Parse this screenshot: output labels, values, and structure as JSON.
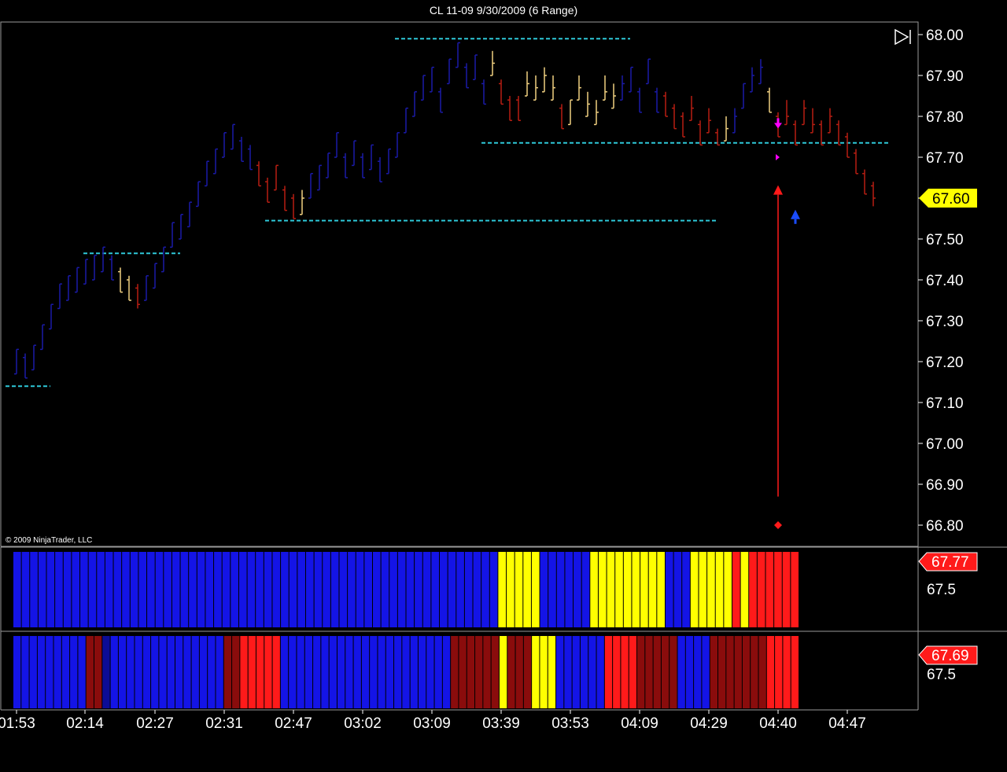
{
  "window": {
    "title": "CL 11-09  9/30/2009 (6 Range)"
  },
  "copyright": "© 2009 NinjaTrader, LLC",
  "colors": {
    "up_bar": "#1a1aa8",
    "down_bar": "#b81e12",
    "neutral_bar": "#f0d080",
    "level_line": "#2ec8d8",
    "panel_blue": "#1414e6",
    "panel_dark_blue": "#0c0c96",
    "panel_yellow": "#ffff00",
    "panel_red": "#ff1a1a",
    "panel_dark_red": "#8a0c0c",
    "signal_red": "#ff1a1a",
    "signal_magenta": "#ff00ff",
    "signal_blue": "#1a4cff",
    "last_price_badge": "#ffff00"
  },
  "price_axis": {
    "ticks": [
      "68.00",
      "67.90",
      "67.80",
      "67.70",
      "67.60",
      "67.50",
      "67.40",
      "67.30",
      "67.20",
      "67.10",
      "67.00",
      "66.90",
      "66.80"
    ],
    "last_price": "67.60"
  },
  "time_axis": {
    "ticks": [
      "01:53",
      "02:14",
      "02:27",
      "02:31",
      "02:47",
      "03:02",
      "03:09",
      "03:39",
      "03:53",
      "04:09",
      "04:29",
      "04:40",
      "04:47"
    ]
  },
  "chart_data": [
    {
      "type": "ohlc",
      "title": "CL 11-09  9/30/2009 (6 Range)",
      "ylim": [
        66.76,
        68.02
      ],
      "levels": [
        {
          "price": 67.14,
          "from_bar": 0,
          "to_bar": 3
        },
        {
          "price": 67.465,
          "from_bar": 9,
          "to_bar": 18
        },
        {
          "price": 67.545,
          "from_bar": 30,
          "to_bar": 80
        },
        {
          "price": 67.735,
          "from_bar": 55,
          "to_bar": 100
        },
        {
          "price": 67.99,
          "from_bar": 45,
          "to_bar": 70
        }
      ],
      "bars": [
        {
          "o": 67.17,
          "h": 67.23,
          "l": 67.17,
          "c": 67.23,
          "d": "up"
        },
        {
          "o": 67.21,
          "h": 67.22,
          "l": 67.16,
          "c": 67.16,
          "d": "up"
        },
        {
          "o": 67.18,
          "h": 67.24,
          "l": 67.18,
          "c": 67.24,
          "d": "up"
        },
        {
          "o": 67.23,
          "h": 67.29,
          "l": 67.23,
          "c": 67.29,
          "d": "up"
        },
        {
          "o": 67.28,
          "h": 67.34,
          "l": 67.28,
          "c": 67.34,
          "d": "up"
        },
        {
          "o": 67.33,
          "h": 67.39,
          "l": 67.33,
          "c": 67.39,
          "d": "up"
        },
        {
          "o": 67.35,
          "h": 67.41,
          "l": 67.35,
          "c": 67.41,
          "d": "up"
        },
        {
          "o": 67.37,
          "h": 67.43,
          "l": 67.37,
          "c": 67.43,
          "d": "up"
        },
        {
          "o": 67.39,
          "h": 67.45,
          "l": 67.39,
          "c": 67.45,
          "d": "up"
        },
        {
          "o": 67.4,
          "h": 67.46,
          "l": 67.4,
          "c": 67.46,
          "d": "up"
        },
        {
          "o": 67.42,
          "h": 67.48,
          "l": 67.42,
          "c": 67.48,
          "d": "up"
        },
        {
          "o": 67.45,
          "h": 67.46,
          "l": 67.4,
          "c": 67.4,
          "d": "up"
        },
        {
          "o": 67.42,
          "h": 67.43,
          "l": 67.37,
          "c": 67.37,
          "d": "neutral"
        },
        {
          "o": 67.4,
          "h": 67.41,
          "l": 67.35,
          "c": 67.35,
          "d": "neutral"
        },
        {
          "o": 67.38,
          "h": 67.39,
          "l": 67.33,
          "c": 67.34,
          "d": "down"
        },
        {
          "o": 67.35,
          "h": 67.41,
          "l": 67.35,
          "c": 67.41,
          "d": "up"
        },
        {
          "o": 67.38,
          "h": 67.44,
          "l": 67.38,
          "c": 67.44,
          "d": "up"
        },
        {
          "o": 67.42,
          "h": 67.48,
          "l": 67.42,
          "c": 67.48,
          "d": "up"
        },
        {
          "o": 67.48,
          "h": 67.54,
          "l": 67.48,
          "c": 67.54,
          "d": "up"
        },
        {
          "o": 67.5,
          "h": 67.56,
          "l": 67.5,
          "c": 67.56,
          "d": "up"
        },
        {
          "o": 67.53,
          "h": 67.59,
          "l": 67.53,
          "c": 67.59,
          "d": "up"
        },
        {
          "o": 67.58,
          "h": 67.64,
          "l": 67.58,
          "c": 67.64,
          "d": "up"
        },
        {
          "o": 67.63,
          "h": 67.69,
          "l": 67.63,
          "c": 67.69,
          "d": "up"
        },
        {
          "o": 67.66,
          "h": 67.72,
          "l": 67.66,
          "c": 67.72,
          "d": "up"
        },
        {
          "o": 67.7,
          "h": 67.76,
          "l": 67.7,
          "c": 67.76,
          "d": "up"
        },
        {
          "o": 67.72,
          "h": 67.78,
          "l": 67.72,
          "c": 67.78,
          "d": "up"
        },
        {
          "o": 67.74,
          "h": 67.75,
          "l": 67.69,
          "c": 67.69,
          "d": "up"
        },
        {
          "o": 67.72,
          "h": 67.73,
          "l": 67.67,
          "c": 67.67,
          "d": "up"
        },
        {
          "o": 67.68,
          "h": 67.69,
          "l": 67.63,
          "c": 67.63,
          "d": "down"
        },
        {
          "o": 67.64,
          "h": 67.65,
          "l": 67.59,
          "c": 67.59,
          "d": "down"
        },
        {
          "o": 67.62,
          "h": 67.68,
          "l": 67.62,
          "c": 67.68,
          "d": "down"
        },
        {
          "o": 67.62,
          "h": 67.63,
          "l": 67.57,
          "c": 67.57,
          "d": "down"
        },
        {
          "o": 67.6,
          "h": 67.61,
          "l": 67.55,
          "c": 67.55,
          "d": "down"
        },
        {
          "o": 67.56,
          "h": 67.62,
          "l": 67.56,
          "c": 67.6,
          "d": "neutral"
        },
        {
          "o": 67.6,
          "h": 67.66,
          "l": 67.6,
          "c": 67.66,
          "d": "up"
        },
        {
          "o": 67.62,
          "h": 67.68,
          "l": 67.62,
          "c": 67.68,
          "d": "up"
        },
        {
          "o": 67.65,
          "h": 67.71,
          "l": 67.65,
          "c": 67.71,
          "d": "up"
        },
        {
          "o": 67.7,
          "h": 67.76,
          "l": 67.7,
          "c": 67.76,
          "d": "up"
        },
        {
          "o": 67.7,
          "h": 67.71,
          "l": 67.65,
          "c": 67.65,
          "d": "up"
        },
        {
          "o": 67.68,
          "h": 67.74,
          "l": 67.68,
          "c": 67.74,
          "d": "up"
        },
        {
          "o": 67.7,
          "h": 67.71,
          "l": 67.65,
          "c": 67.65,
          "d": "up"
        },
        {
          "o": 67.67,
          "h": 67.73,
          "l": 67.67,
          "c": 67.73,
          "d": "up"
        },
        {
          "o": 67.69,
          "h": 67.7,
          "l": 67.64,
          "c": 67.64,
          "d": "up"
        },
        {
          "o": 67.66,
          "h": 67.72,
          "l": 67.66,
          "c": 67.72,
          "d": "up"
        },
        {
          "o": 67.7,
          "h": 67.76,
          "l": 67.7,
          "c": 67.76,
          "d": "up"
        },
        {
          "o": 67.76,
          "h": 67.82,
          "l": 67.76,
          "c": 67.82,
          "d": "up"
        },
        {
          "o": 67.8,
          "h": 67.86,
          "l": 67.8,
          "c": 67.86,
          "d": "up"
        },
        {
          "o": 67.84,
          "h": 67.9,
          "l": 67.84,
          "c": 67.9,
          "d": "up"
        },
        {
          "o": 67.86,
          "h": 67.92,
          "l": 67.86,
          "c": 67.92,
          "d": "up"
        },
        {
          "o": 67.86,
          "h": 67.87,
          "l": 67.81,
          "c": 67.81,
          "d": "up"
        },
        {
          "o": 67.88,
          "h": 67.94,
          "l": 67.88,
          "c": 67.94,
          "d": "up"
        },
        {
          "o": 67.92,
          "h": 67.98,
          "l": 67.92,
          "c": 67.98,
          "d": "up"
        },
        {
          "o": 67.92,
          "h": 67.93,
          "l": 67.87,
          "c": 67.87,
          "d": "up"
        },
        {
          "o": 67.89,
          "h": 67.95,
          "l": 67.89,
          "c": 67.95,
          "d": "up"
        },
        {
          "o": 67.88,
          "h": 67.89,
          "l": 67.83,
          "c": 67.83,
          "d": "up"
        },
        {
          "o": 67.9,
          "h": 67.96,
          "l": 67.9,
          "c": 67.93,
          "d": "neutral"
        },
        {
          "o": 67.88,
          "h": 67.89,
          "l": 67.83,
          "c": 67.83,
          "d": "down"
        },
        {
          "o": 67.84,
          "h": 67.85,
          "l": 67.79,
          "c": 67.79,
          "d": "down"
        },
        {
          "o": 67.84,
          "h": 67.85,
          "l": 67.79,
          "c": 67.79,
          "d": "down"
        },
        {
          "o": 67.85,
          "h": 67.91,
          "l": 67.85,
          "c": 67.88,
          "d": "neutral"
        },
        {
          "o": 67.84,
          "h": 67.9,
          "l": 67.84,
          "c": 67.87,
          "d": "neutral"
        },
        {
          "o": 67.86,
          "h": 67.92,
          "l": 67.86,
          "c": 67.9,
          "d": "neutral"
        },
        {
          "o": 67.84,
          "h": 67.9,
          "l": 67.84,
          "c": 67.87,
          "d": "neutral"
        },
        {
          "o": 67.82,
          "h": 67.83,
          "l": 67.77,
          "c": 67.77,
          "d": "down"
        },
        {
          "o": 67.78,
          "h": 67.84,
          "l": 67.78,
          "c": 67.84,
          "d": "neutral"
        },
        {
          "o": 67.84,
          "h": 67.9,
          "l": 67.84,
          "c": 67.87,
          "d": "neutral"
        },
        {
          "o": 67.8,
          "h": 67.86,
          "l": 67.8,
          "c": 67.83,
          "d": "neutral"
        },
        {
          "o": 67.78,
          "h": 67.84,
          "l": 67.78,
          "c": 67.81,
          "d": "neutral"
        },
        {
          "o": 67.84,
          "h": 67.9,
          "l": 67.84,
          "c": 67.86,
          "d": "neutral"
        },
        {
          "o": 67.82,
          "h": 67.88,
          "l": 67.82,
          "c": 67.85,
          "d": "neutral"
        },
        {
          "o": 67.84,
          "h": 67.9,
          "l": 67.84,
          "c": 67.88,
          "d": "up"
        },
        {
          "o": 67.86,
          "h": 67.92,
          "l": 67.86,
          "c": 67.92,
          "d": "up"
        },
        {
          "o": 67.86,
          "h": 67.87,
          "l": 67.81,
          "c": 67.81,
          "d": "up"
        },
        {
          "o": 67.88,
          "h": 67.94,
          "l": 67.88,
          "c": 67.94,
          "d": "up"
        },
        {
          "o": 67.86,
          "h": 67.87,
          "l": 67.81,
          "c": 67.81,
          "d": "up"
        },
        {
          "o": 67.85,
          "h": 67.86,
          "l": 67.8,
          "c": 67.8,
          "d": "down"
        },
        {
          "o": 67.82,
          "h": 67.83,
          "l": 67.77,
          "c": 67.77,
          "d": "down"
        },
        {
          "o": 67.8,
          "h": 67.81,
          "l": 67.75,
          "c": 67.75,
          "d": "down"
        },
        {
          "o": 67.79,
          "h": 67.85,
          "l": 67.79,
          "c": 67.82,
          "d": "down"
        },
        {
          "o": 67.78,
          "h": 67.79,
          "l": 67.73,
          "c": 67.73,
          "d": "down"
        },
        {
          "o": 67.76,
          "h": 67.82,
          "l": 67.76,
          "c": 67.79,
          "d": "down"
        },
        {
          "o": 67.76,
          "h": 67.77,
          "l": 67.73,
          "c": 67.73,
          "d": "down"
        },
        {
          "o": 67.74,
          "h": 67.8,
          "l": 67.74,
          "c": 67.77,
          "d": "neutral"
        },
        {
          "o": 67.76,
          "h": 67.82,
          "l": 67.76,
          "c": 67.8,
          "d": "up"
        },
        {
          "o": 67.82,
          "h": 67.88,
          "l": 67.82,
          "c": 67.88,
          "d": "up"
        },
        {
          "o": 67.86,
          "h": 67.92,
          "l": 67.86,
          "c": 67.9,
          "d": "up"
        },
        {
          "o": 67.88,
          "h": 67.94,
          "l": 67.88,
          "c": 67.92,
          "d": "up"
        },
        {
          "o": 67.86,
          "h": 67.87,
          "l": 67.81,
          "c": 67.81,
          "d": "neutral"
        },
        {
          "o": 67.8,
          "h": 67.81,
          "l": 67.75,
          "c": 67.75,
          "d": "down"
        },
        {
          "o": 67.78,
          "h": 67.84,
          "l": 67.78,
          "c": 67.8,
          "d": "down"
        },
        {
          "o": 67.78,
          "h": 67.79,
          "l": 67.73,
          "c": 67.73,
          "d": "down"
        },
        {
          "o": 67.78,
          "h": 67.84,
          "l": 67.78,
          "c": 67.82,
          "d": "down"
        },
        {
          "o": 67.76,
          "h": 67.82,
          "l": 67.76,
          "c": 67.78,
          "d": "down"
        },
        {
          "o": 67.78,
          "h": 67.79,
          "l": 67.73,
          "c": 67.73,
          "d": "down"
        },
        {
          "o": 67.76,
          "h": 67.82,
          "l": 67.76,
          "c": 67.8,
          "d": "down"
        },
        {
          "o": 67.78,
          "h": 67.79,
          "l": 67.73,
          "c": 67.73,
          "d": "down"
        },
        {
          "o": 67.75,
          "h": 67.76,
          "l": 67.7,
          "c": 67.7,
          "d": "down"
        },
        {
          "o": 67.71,
          "h": 67.72,
          "l": 67.66,
          "c": 67.66,
          "d": "down"
        },
        {
          "o": 67.66,
          "h": 67.67,
          "l": 67.61,
          "c": 67.61,
          "d": "down"
        },
        {
          "o": 67.63,
          "h": 67.64,
          "l": 67.58,
          "c": 67.6,
          "d": "down"
        }
      ],
      "signals": [
        {
          "bar": 88,
          "type": "up-arrow",
          "price": 67.62,
          "color": "red"
        },
        {
          "bar": 88,
          "type": "diamond",
          "price": 66.8,
          "color": "red"
        },
        {
          "bar": 88,
          "type": "down-arrow",
          "price": 67.78,
          "color": "magenta"
        },
        {
          "bar": 88,
          "type": "tick",
          "price": 67.7,
          "color": "magenta"
        },
        {
          "bar": 90,
          "type": "up-arrow",
          "price": 67.56,
          "color": "blue"
        }
      ]
    },
    {
      "type": "heatmap",
      "value_label": "67.77",
      "axis_label": "67.5",
      "colors_seq": "BBBBBBBBBBBBBBBBBBBBBBBBBBBBBBBBBBBBBBBBBBBBBBBBBBBBBBBBBBYYYYYBBBBBBYYYYYYYYYBBBYYYYYRYRRRRRR"
    },
    {
      "type": "heatmap",
      "value_label": "67.69",
      "axis_label": "67.5",
      "colors_seq": "BBBBBBBBBDDdBBBBBBBBBBBBBBDDRRRRRBBBBBBBBBBBBBBBBBBBBBDDDDDDYDDDYYYBBBBBBRRRRDDDDDBBBBDDDDDDDRRRR"
    }
  ]
}
